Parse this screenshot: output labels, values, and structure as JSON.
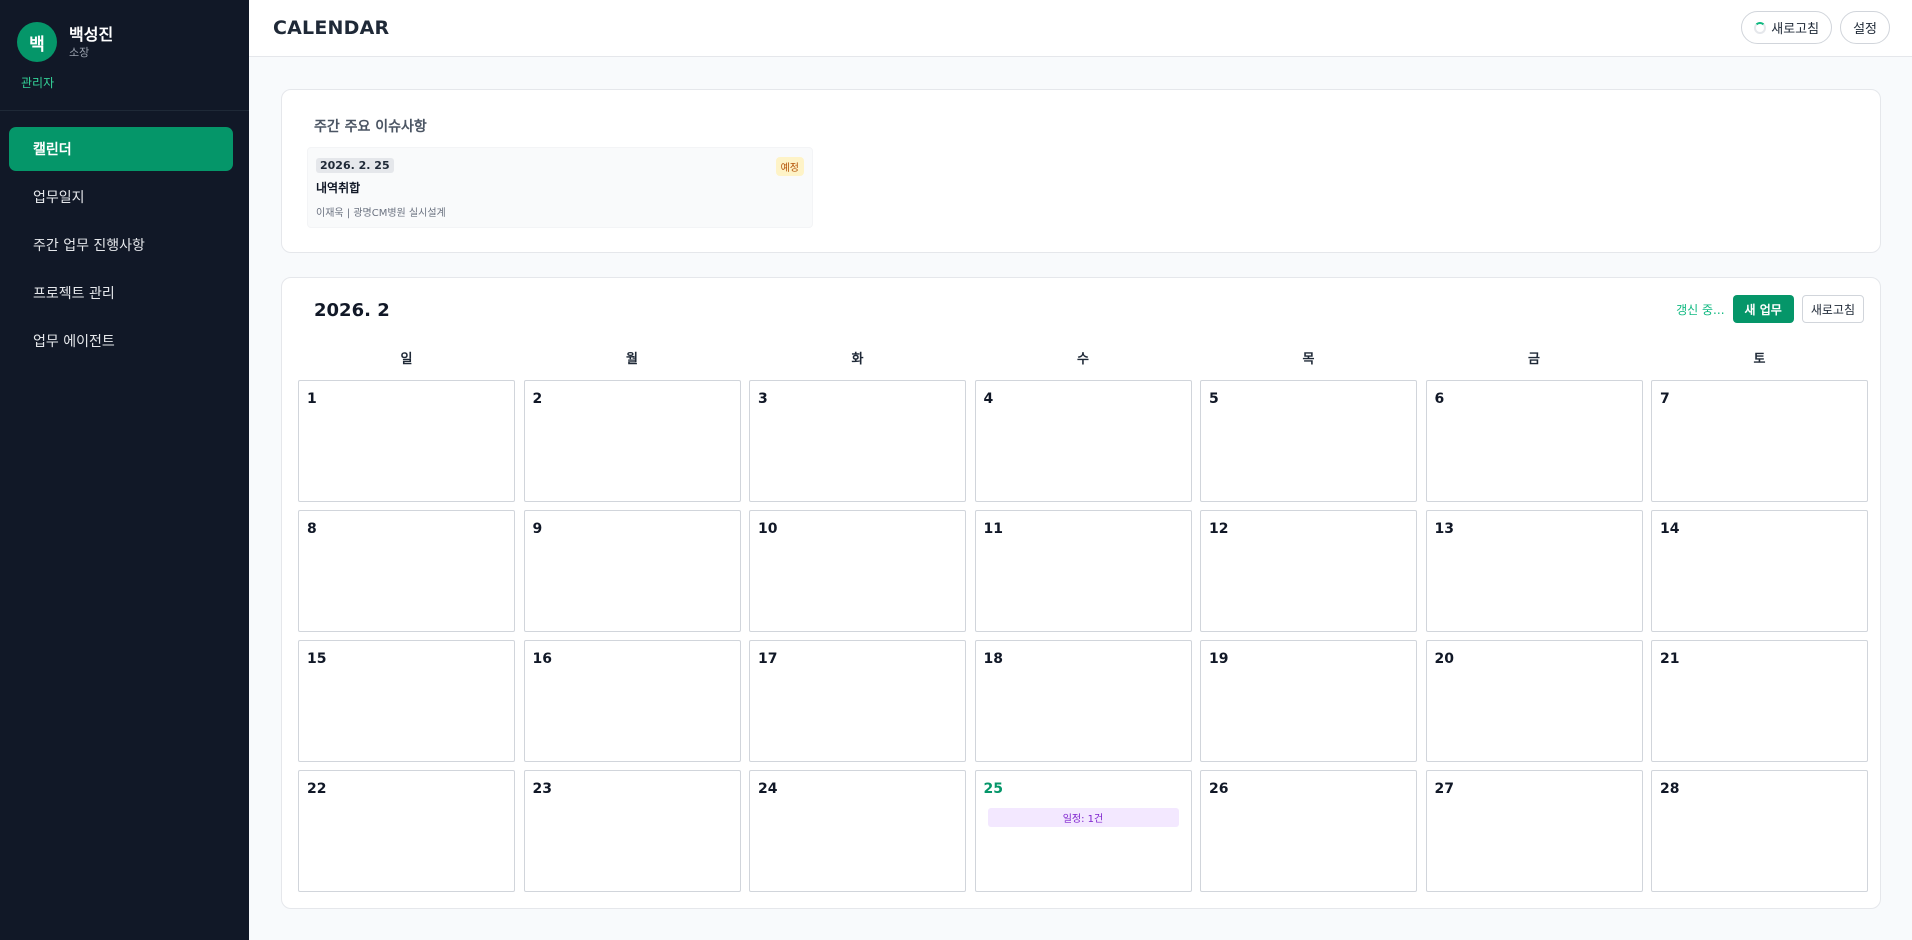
{
  "user": {
    "avatar_initial": "백",
    "name": "백성진",
    "title": "소장",
    "role": "관리자"
  },
  "nav": [
    {
      "label": "캘린더",
      "active": true
    },
    {
      "label": "업무일지",
      "active": false
    },
    {
      "label": "주간 업무 진행사항",
      "active": false
    },
    {
      "label": "프로젝트 관리",
      "active": false
    },
    {
      "label": "업무 에이전트",
      "active": false
    }
  ],
  "header": {
    "title": "CALENDAR",
    "refresh_label": "새로고침",
    "settings_label": "설정"
  },
  "issues": {
    "title": "주간 주요 이슈사항",
    "items": [
      {
        "date": "2026. 2. 25",
        "badge": "예정",
        "name": "내역취합",
        "meta": "이재욱 | 광명CM병원 실시설계"
      }
    ]
  },
  "calendar": {
    "title": "2026. 2",
    "status_text": "갱신 중...",
    "new_label": "새 업무",
    "refresh_label": "새로고침",
    "weekdays": [
      "일",
      "월",
      "화",
      "수",
      "목",
      "금",
      "토"
    ],
    "days": [
      {
        "num": "1"
      },
      {
        "num": "2"
      },
      {
        "num": "3"
      },
      {
        "num": "4"
      },
      {
        "num": "5"
      },
      {
        "num": "6"
      },
      {
        "num": "7"
      },
      {
        "num": "8"
      },
      {
        "num": "9"
      },
      {
        "num": "10"
      },
      {
        "num": "11"
      },
      {
        "num": "12"
      },
      {
        "num": "13"
      },
      {
        "num": "14"
      },
      {
        "num": "15"
      },
      {
        "num": "16"
      },
      {
        "num": "17"
      },
      {
        "num": "18"
      },
      {
        "num": "19"
      },
      {
        "num": "20"
      },
      {
        "num": "21"
      },
      {
        "num": "22"
      },
      {
        "num": "23"
      },
      {
        "num": "24"
      },
      {
        "num": "25",
        "today": true,
        "event": "일정: 1건"
      },
      {
        "num": "26"
      },
      {
        "num": "27"
      },
      {
        "num": "28"
      }
    ]
  },
  "colors": {
    "sidebar_bg": "#111827",
    "accent": "#059669",
    "event_bg": "#f3e8ff",
    "event_text": "#7e22ce",
    "badge_bg": "#fef3c7"
  }
}
